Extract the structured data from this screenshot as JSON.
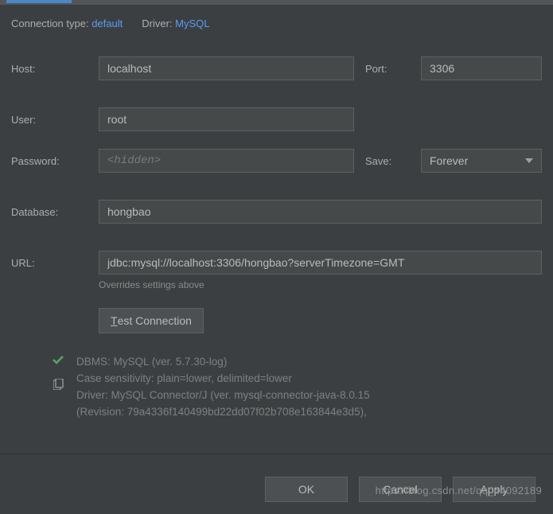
{
  "meta": {
    "connection_type_label": "Connection type:",
    "connection_type_value": "default",
    "driver_label": "Driver:",
    "driver_value": "MySQL"
  },
  "labels": {
    "host": "Host:",
    "port": "Port:",
    "user": "User:",
    "password": "Password:",
    "save": "Save:",
    "database": "Database:",
    "url": "URL:"
  },
  "values": {
    "host": "localhost",
    "port": "3306",
    "user": "root",
    "password_placeholder": "<hidden>",
    "save_mode": "Forever",
    "database": "hongbao",
    "url": "jdbc:mysql://localhost:3306/hongbao?serverTimezone=GMT"
  },
  "hints": {
    "url_override": "Overrides settings above"
  },
  "buttons": {
    "test_connection_prefix": "T",
    "test_connection_rest": "est Connection",
    "ok": "OK",
    "cancel": "Cancel",
    "apply": "Apply"
  },
  "status": {
    "line1": "DBMS: MySQL (ver. 5.7.30-log)",
    "line2": "Case sensitivity: plain=lower, delimited=lower",
    "line3": "Driver: MySQL Connector/J (ver. mysql-connector-java-8.0.15",
    "line4": "(Revision: 79a4336f140499bd22dd07f02b708e163844e3d5),"
  },
  "watermark": "https://blog.csdn.net/qq_44092189"
}
